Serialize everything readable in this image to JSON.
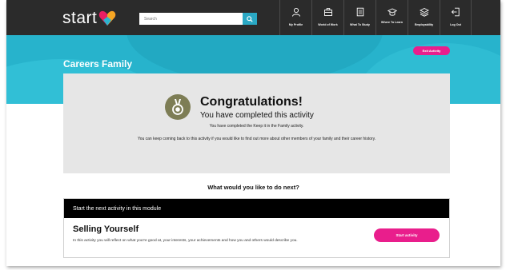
{
  "brand": {
    "logo_text": "start"
  },
  "search": {
    "placeholder": "Search"
  },
  "nav": {
    "items": [
      {
        "label": "My Profile",
        "icon": "person-icon"
      },
      {
        "label": "World of Work",
        "icon": "briefcase-icon"
      },
      {
        "label": "What To Study",
        "icon": "book-icon"
      },
      {
        "label": "Where To Learn",
        "icon": "graduation-cap-icon"
      },
      {
        "label": "Employability",
        "icon": "layers-icon"
      },
      {
        "label": "Log Out",
        "icon": "logout-icon"
      }
    ]
  },
  "page": {
    "title": "Careers Family",
    "exit_label": "Exit Activity"
  },
  "congrats": {
    "title": "Congratulations!",
    "subtitle": "You have completed this activity",
    "line1": "You have completed the Keep it in the Family activity.",
    "line2": "You can keep coming back to this activity if you would like to find out more about other members of your family and their career history."
  },
  "next": {
    "question": "What would you like to do next?",
    "header": "Start the next activity in this module",
    "activity_title": "Selling Yourself",
    "activity_desc": "In this activity you will reflect on what you're good at, your interests, your achievements and how you and others would describe you.",
    "start_label": "Start activity"
  },
  "colors": {
    "topbar": "#2b2b2b",
    "banner": "#27b3cc",
    "accent_pink": "#e91e8c",
    "search_button": "#2aa8c4",
    "card_grey": "#e6e6e6"
  }
}
